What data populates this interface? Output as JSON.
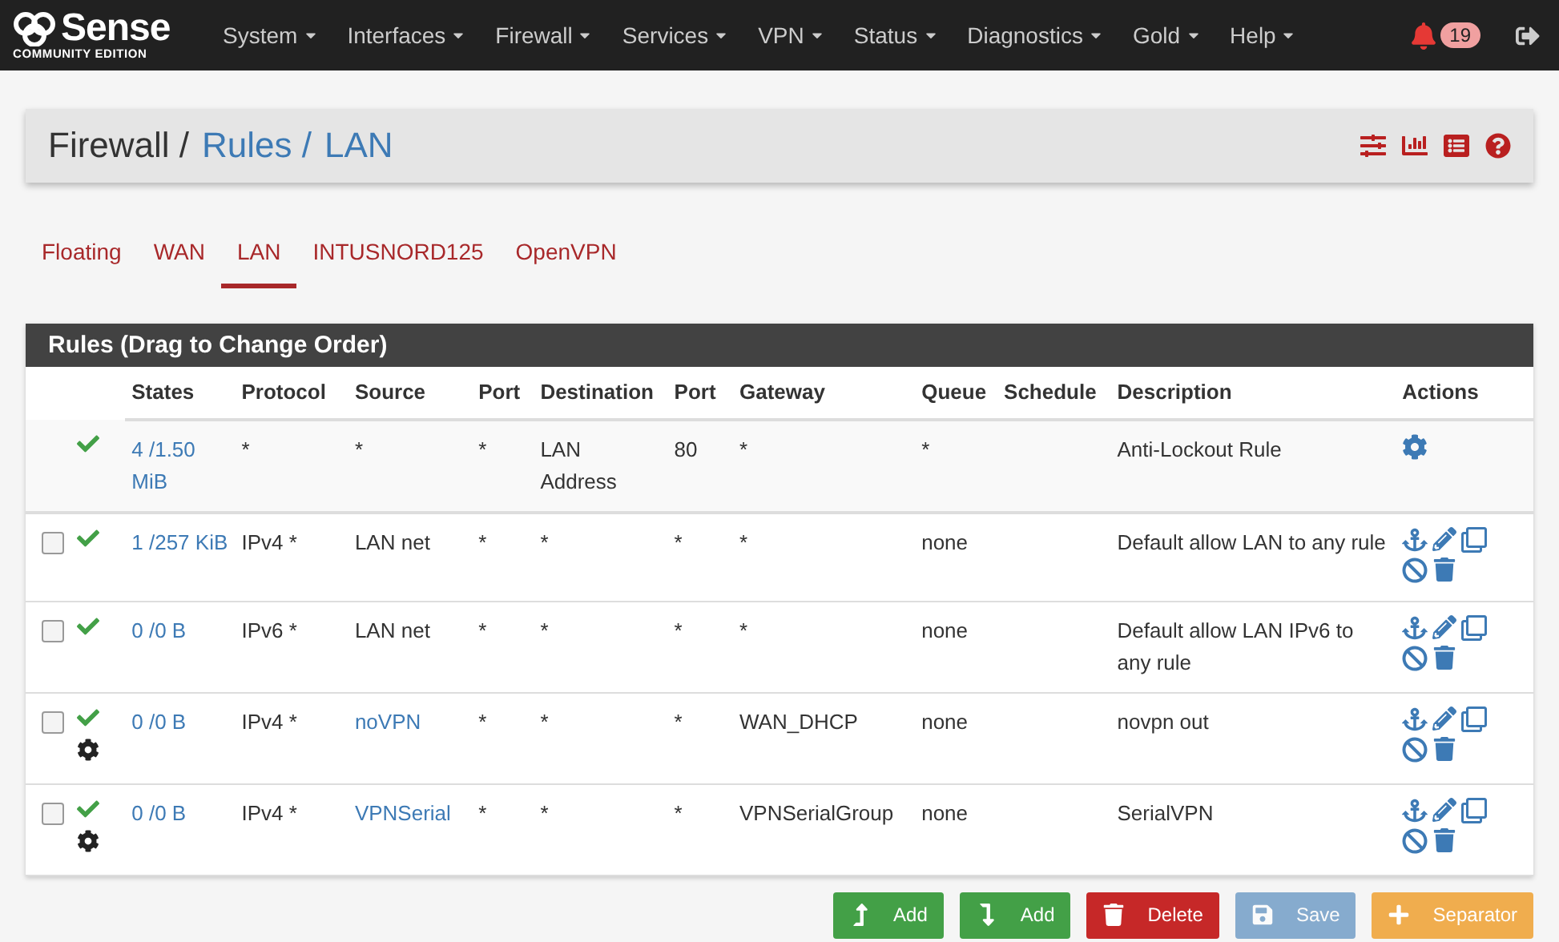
{
  "navbar": {
    "logo": {
      "name": "Sense",
      "edition": "COMMUNITY EDITION"
    },
    "menu": [
      {
        "label": "System"
      },
      {
        "label": "Interfaces"
      },
      {
        "label": "Firewall"
      },
      {
        "label": "Services"
      },
      {
        "label": "VPN"
      },
      {
        "label": "Status"
      },
      {
        "label": "Diagnostics"
      },
      {
        "label": "Gold"
      },
      {
        "label": "Help"
      }
    ],
    "notifications": "19"
  },
  "breadcrumb": [
    {
      "label": "Firewall /",
      "link": false
    },
    {
      "label": "Rules /",
      "link": true
    },
    {
      "label": "LAN",
      "link": true
    }
  ],
  "tabs": [
    {
      "label": "Floating",
      "selected": false
    },
    {
      "label": "WAN",
      "selected": false
    },
    {
      "label": "LAN",
      "selected": true
    },
    {
      "label": "INTUSNORD125",
      "selected": false
    },
    {
      "label": "OpenVPN",
      "selected": false
    }
  ],
  "panel": {
    "title": "Rules (Drag to Change Order)",
    "columns": [
      "States",
      "Protocol",
      "Source",
      "Port",
      "Destination",
      "Port",
      "Gateway",
      "Queue",
      "Schedule",
      "Description",
      "Actions"
    ],
    "rows": [
      {
        "kind": "system",
        "advanced": false,
        "states": "4 /1.50 MiB",
        "protocol": "*",
        "source": {
          "text": "*",
          "link": false
        },
        "source_port": "*",
        "destination": "LAN Address",
        "destination_port": "80",
        "gateway": "*",
        "queue": "*",
        "description": "Anti-Lockout Rule"
      },
      {
        "kind": "user",
        "checked": false,
        "advanced": false,
        "states": "1 /257 KiB",
        "protocol": "IPv4 *",
        "source": {
          "text": "LAN net",
          "link": false
        },
        "source_port": "*",
        "destination": "*",
        "destination_port": "*",
        "gateway": "*",
        "queue": "none",
        "description": "Default allow LAN to any rule"
      },
      {
        "kind": "user",
        "checked": false,
        "advanced": false,
        "states": "0 /0 B",
        "protocol": "IPv6 *",
        "source": {
          "text": "LAN net",
          "link": false
        },
        "source_port": "*",
        "destination": "*",
        "destination_port": "*",
        "gateway": "*",
        "queue": "none",
        "description": "Default allow LAN IPv6 to any rule"
      },
      {
        "kind": "user",
        "checked": false,
        "advanced": true,
        "states": "0 /0 B",
        "protocol": "IPv4 *",
        "source": {
          "text": "noVPN",
          "link": true
        },
        "source_port": "*",
        "destination": "*",
        "destination_port": "*",
        "gateway": "WAN_DHCP",
        "queue": "none",
        "description": "novpn out"
      },
      {
        "kind": "user",
        "checked": false,
        "advanced": true,
        "states": "0 /0 B",
        "protocol": "IPv4 *",
        "source": {
          "text": "VPNSerial",
          "link": true
        },
        "source_port": "*",
        "destination": "*",
        "destination_port": "*",
        "gateway": "VPNSerialGroup",
        "queue": "none",
        "description": "SerialVPN"
      }
    ]
  },
  "buttons": [
    {
      "kind": "add_top",
      "label": "Add",
      "disabled": false
    },
    {
      "kind": "add_bottom",
      "label": "Add",
      "disabled": false
    },
    {
      "kind": "delete",
      "label": "Delete",
      "disabled": false
    },
    {
      "kind": "save",
      "label": "Save",
      "disabled": true
    },
    {
      "kind": "separator",
      "label": "Separator",
      "disabled": false
    }
  ]
}
